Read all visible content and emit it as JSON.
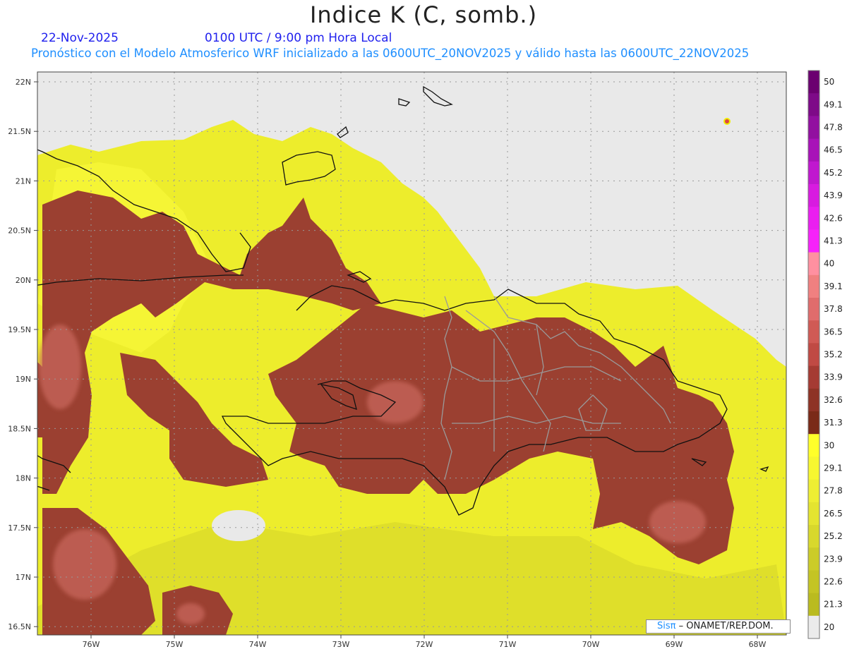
{
  "title": "Indice K (C, somb.)",
  "date": "22-Nov-2025",
  "valid_time": "0100 UTC / 9:00 pm Hora Local",
  "description": "Pronóstico con el Modelo Atmosferico WRF inicializado a las 0600UTC_20NOV2025 y válido hasta las  0600UTC_22NOV2025",
  "credit": {
    "brand": "Sisπ",
    "text": " –  ONAMET/REP.DOM."
  },
  "lat_labels": [
    "22N",
    "21.5N",
    "21N",
    "20.5N",
    "20N",
    "19.5N",
    "19N",
    "18.5N",
    "18N",
    "17.5N",
    "17N",
    "16.5N"
  ],
  "lon_labels": [
    "76W",
    "75W",
    "74W",
    "73W",
    "72W",
    "71W",
    "70W",
    "69W",
    "68W"
  ],
  "colorbar": {
    "labels": [
      "50",
      "49.1",
      "47.8",
      "46.5",
      "45.2",
      "43.9",
      "42.6",
      "41.3",
      "40",
      "39.1",
      "37.8",
      "36.5",
      "35.2",
      "33.9",
      "32.6",
      "31.3",
      "30",
      "29.1",
      "27.8",
      "26.5",
      "25.2",
      "23.9",
      "22.6",
      "21.3",
      "20"
    ],
    "colors": [
      "#6b0070",
      "#7e0a88",
      "#9210a0",
      "#a812b8",
      "#c018cf",
      "#d81be0",
      "#ea1ef0",
      "#f622fa",
      "#ff90a0",
      "#f08080",
      "#e06c6c",
      "#d05a55",
      "#c04a44",
      "#a53b33",
      "#8e3325",
      "#7a2a18",
      "#ffff2a",
      "#f7f730",
      "#eeee33",
      "#e4e430",
      "#d8d82c",
      "#cccc28",
      "#c4c424",
      "#babb1f",
      "#ebebeb"
    ]
  },
  "colors": {
    "ocean_no_data": "#e9e9e9",
    "k_low": "#f2f22a",
    "k_high": "#9a4133"
  }
}
